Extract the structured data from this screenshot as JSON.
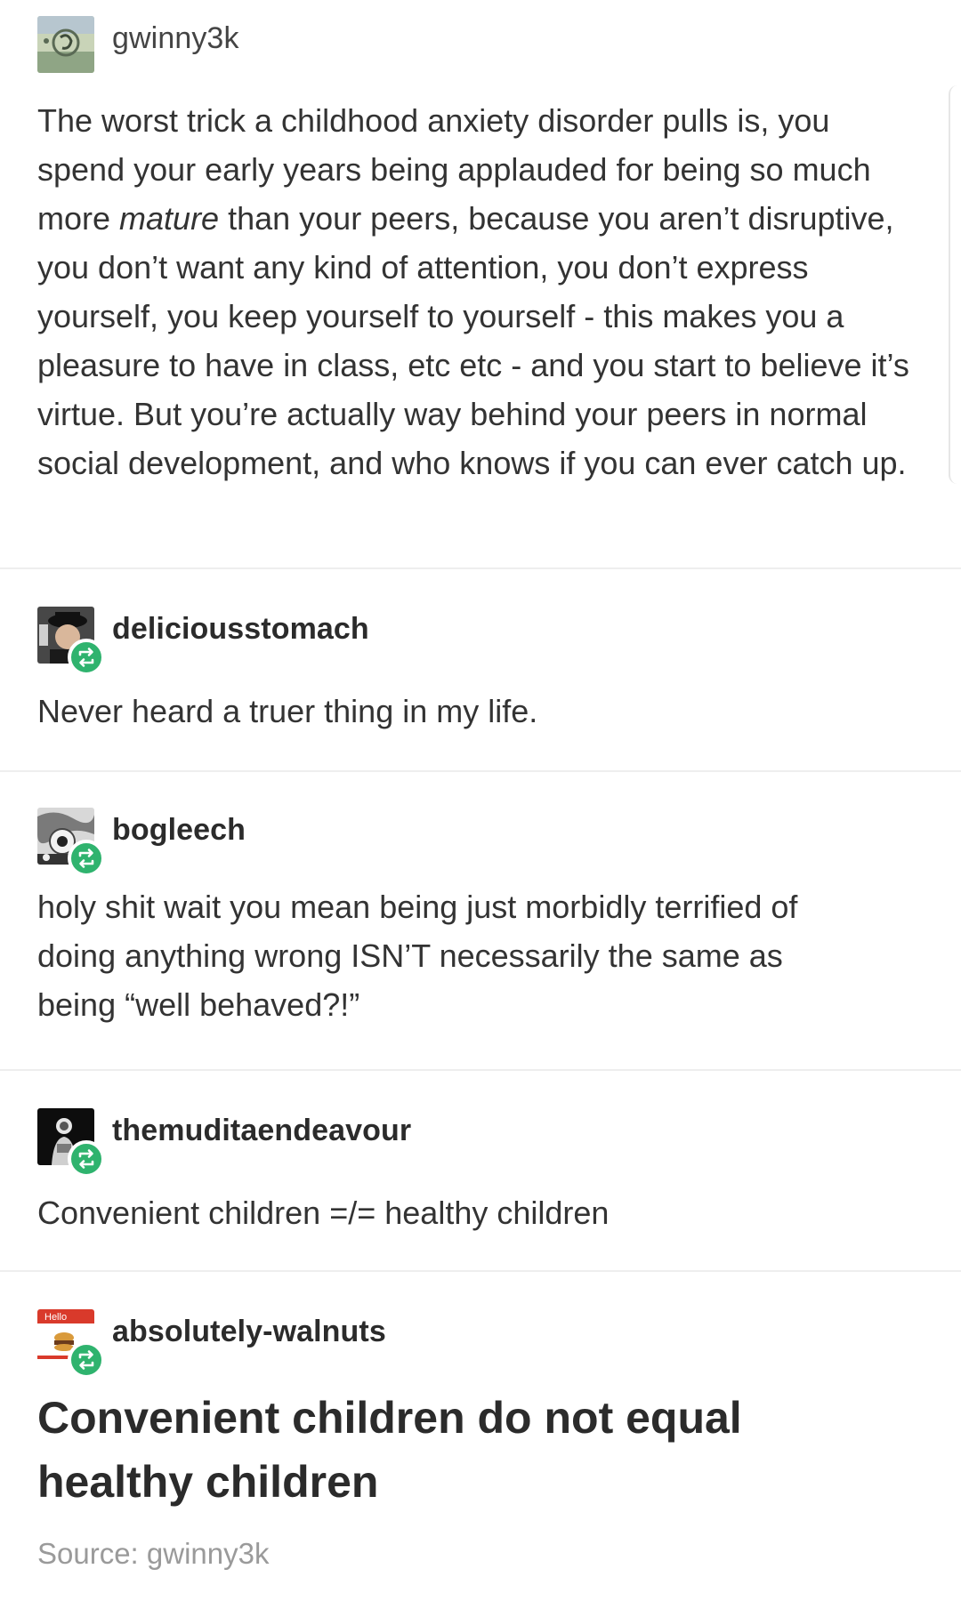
{
  "posts": [
    {
      "username": "gwinny3k",
      "reblog": false,
      "body_before": "The worst trick a childhood anxiety disorder pulls is, you spend your early years being applauded for being so much more ",
      "body_em": "mature",
      "body_after": " than your peers, because you aren’t disruptive, you don’t want any kind of attention, you don’t express yourself, you keep yourself to yourself - this makes you a pleasure to have in class, etc etc - and you start to believe it’s virtue. But you’re actually way behind your peers in normal social development, and who knows if you can ever catch up."
    },
    {
      "username": "deliciousstomach",
      "reblog": true,
      "body": "Never heard a truer thing in my life."
    },
    {
      "username": "bogleech",
      "reblog": true,
      "body": "holy shit wait you mean being just morbidly terrified of doing anything wrong ISN’T necessarily the same as being “well behaved?!”"
    },
    {
      "username": "themuditaendeavour",
      "reblog": true,
      "body": "Convenient children =/= healthy children"
    },
    {
      "username": "absolutely-walnuts",
      "reblog": true,
      "avatar_text": "Hello",
      "body": "Convenient children do not equal healthy children"
    }
  ],
  "source": {
    "label": "Source: gwinny3k"
  },
  "icons": {
    "reblog": "reblog-icon"
  },
  "colors": {
    "reblog_badge": "#2fb36e",
    "text": "#333333",
    "source": "#9a9a9a",
    "divider": "#eeeeee"
  }
}
